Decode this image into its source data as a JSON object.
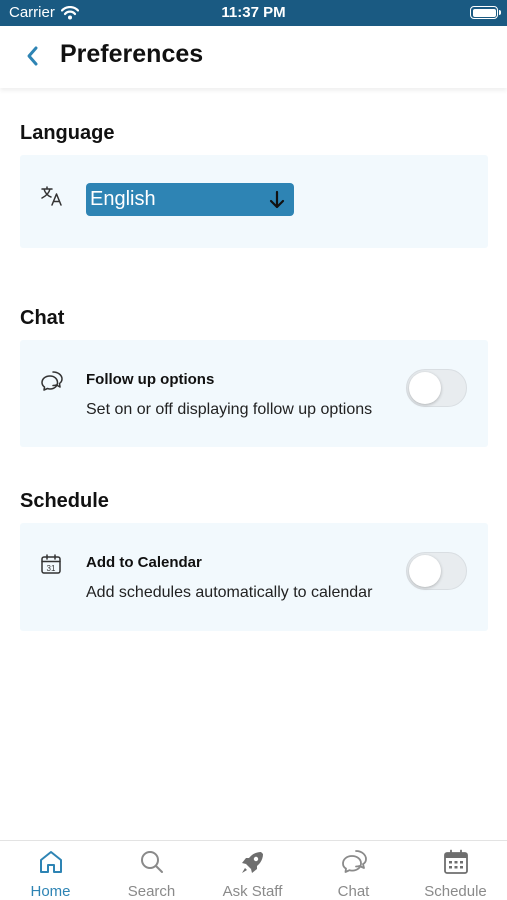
{
  "status_bar": {
    "carrier": "Carrier",
    "time": "11:37 PM"
  },
  "header": {
    "title": "Preferences",
    "back_icon": "chevron-left-icon"
  },
  "sections": {
    "language": {
      "title": "Language",
      "icon": "translate-icon",
      "selected": "English"
    },
    "chat": {
      "title": "Chat",
      "icon": "chat-bubbles-icon",
      "option_title": "Follow up options",
      "option_desc": "Set on or off displaying follow up options",
      "enabled": false
    },
    "schedule": {
      "title": "Schedule",
      "icon": "calendar-icon",
      "calendar_day": "31",
      "option_title": "Add to Calendar",
      "option_desc": "Add schedules automatically to calendar",
      "enabled": false
    }
  },
  "tab_bar": {
    "items": [
      {
        "label": "Home",
        "icon": "home-icon",
        "active": true
      },
      {
        "label": "Search",
        "icon": "search-icon",
        "active": false
      },
      {
        "label": "Ask Staff",
        "icon": "rocket-icon",
        "active": false
      },
      {
        "label": "Chat",
        "icon": "chat-bubbles-icon",
        "active": false
      },
      {
        "label": "Schedule",
        "icon": "calendar-icon",
        "active": false
      }
    ]
  },
  "colors": {
    "status_bar": "#1a5a82",
    "accent": "#2e84b4",
    "card_background": "#f2f9fd",
    "inactive_tab": "#8a8a8a"
  }
}
